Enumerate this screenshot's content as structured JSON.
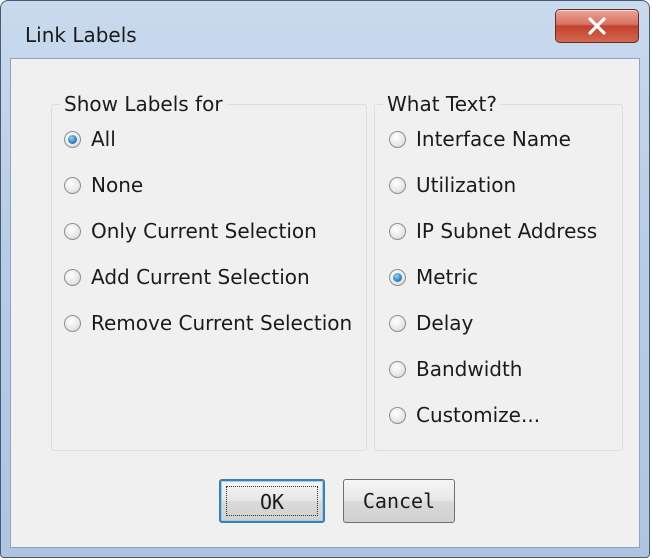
{
  "window": {
    "title": "Link Labels",
    "close_label": "X"
  },
  "show_labels": {
    "title": "Show Labels for",
    "options": [
      {
        "label": "All",
        "checked": true
      },
      {
        "label": "None",
        "checked": false
      },
      {
        "label": "Only Current Selection",
        "checked": false
      },
      {
        "label": "Add Current Selection",
        "checked": false
      },
      {
        "label": "Remove Current Selection",
        "checked": false
      }
    ]
  },
  "what_text": {
    "title": "What Text?",
    "options": [
      {
        "label": "Interface Name",
        "checked": false
      },
      {
        "label": "Utilization",
        "checked": false
      },
      {
        "label": "IP Subnet Address",
        "checked": false
      },
      {
        "label": "Metric",
        "checked": true
      },
      {
        "label": "Delay",
        "checked": false
      },
      {
        "label": "Bandwidth",
        "checked": false
      },
      {
        "label": "Customize...",
        "checked": false
      }
    ]
  },
  "buttons": {
    "ok": "OK",
    "cancel": "Cancel"
  },
  "colors": {
    "title_bar": "#b7cce6",
    "close_button": "#c2422e",
    "dialog_background": "#f0f0f0",
    "radio_selected": "#3a8bc9",
    "default_button_border": "#3c7fb1"
  }
}
